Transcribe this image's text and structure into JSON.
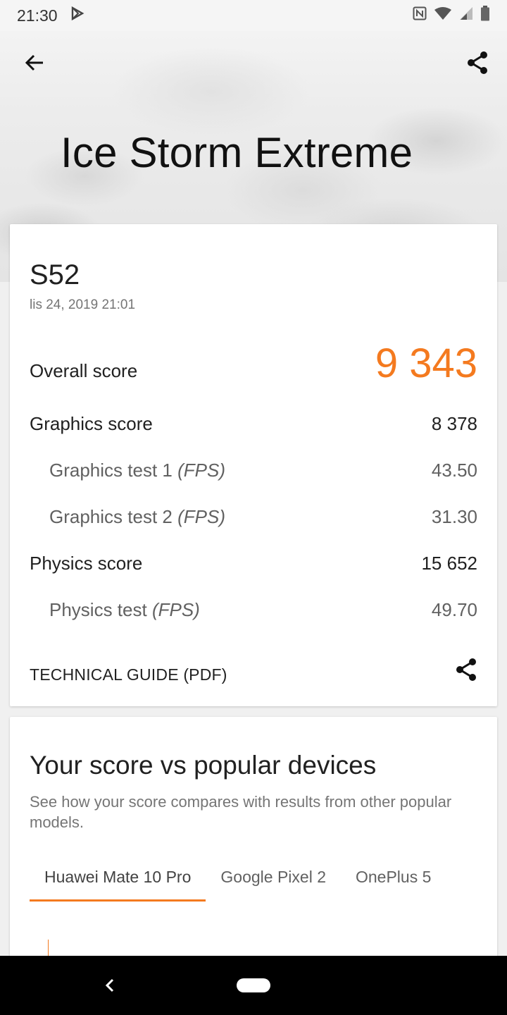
{
  "status_bar": {
    "time": "21:30"
  },
  "header": {
    "title": "Ice Storm Extreme"
  },
  "result": {
    "device": "S52",
    "date": "lis 24, 2019 21:01",
    "overall_label": "Overall score",
    "overall_value": "9 343",
    "graphics_label": "Graphics score",
    "graphics_value": "8 378",
    "gt1_label": "Graphics test 1",
    "gt1_unit": "(FPS)",
    "gt1_value": "43.50",
    "gt2_label": "Graphics test 2",
    "gt2_unit": "(FPS)",
    "gt2_value": "31.30",
    "physics_label": "Physics score",
    "physics_value": "15 652",
    "pt_label": "Physics test",
    "pt_unit": "(FPS)",
    "pt_value": "49.70",
    "tech_guide": "TECHNICAL GUIDE (PDF)"
  },
  "comparison": {
    "title": "Your score vs popular devices",
    "description": "See how your score compares with results from other popular models.",
    "tabs": [
      {
        "label": "Huawei Mate 10 Pro",
        "active": true
      },
      {
        "label": "Google Pixel 2",
        "active": false
      },
      {
        "label": "OnePlus 5",
        "active": false
      }
    ]
  },
  "colors": {
    "accent": "#f47a1f"
  },
  "icons": [
    "back-arrow-icon",
    "share-icon",
    "nfc-icon",
    "wifi-icon",
    "signal-icon",
    "battery-icon",
    "play-store-icon",
    "nav-back-icon",
    "nav-home-pill"
  ]
}
